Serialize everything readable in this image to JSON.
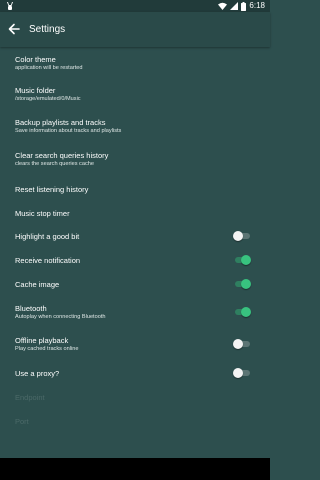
{
  "status_bar": {
    "app_icon": "bunny-icon",
    "icons": [
      "wifi-icon",
      "signal-icon",
      "battery-icon"
    ],
    "time": "6:18"
  },
  "app_bar": {
    "title": "Settings",
    "back_icon": "arrow-left-icon"
  },
  "settings": [
    {
      "title": "Color theme",
      "subtitle": "application will be restarted"
    },
    {
      "title": "Music folder",
      "subtitle": "/storage/emulated/0/Music"
    },
    {
      "title": "Backup playlists and tracks",
      "subtitle": "Save information about tracks and playlists"
    },
    {
      "title": "Clear search queries history",
      "subtitle": "clears the search queries cache"
    },
    {
      "title": "Reset listening history"
    },
    {
      "title": "Music stop timer"
    },
    {
      "title": "Highlight a good bit",
      "toggle": false
    },
    {
      "title": "Receive notification",
      "toggle": true
    },
    {
      "title": "Cache image",
      "toggle": true
    },
    {
      "title": "Bluetooth",
      "subtitle": "Autoplay when connecting Bluetooth",
      "toggle": true
    },
    {
      "title": "Offline playback",
      "subtitle": "Play cached tracks online",
      "toggle": false
    },
    {
      "title": "Use a proxy?",
      "toggle": false
    },
    {
      "title": "Endpoint",
      "disabled": true
    },
    {
      "title": "Port",
      "disabled": true
    }
  ],
  "colors": {
    "background": "#2d4f4e",
    "app_bar": "#2a4a49",
    "toggle_on": "#38c27f"
  }
}
